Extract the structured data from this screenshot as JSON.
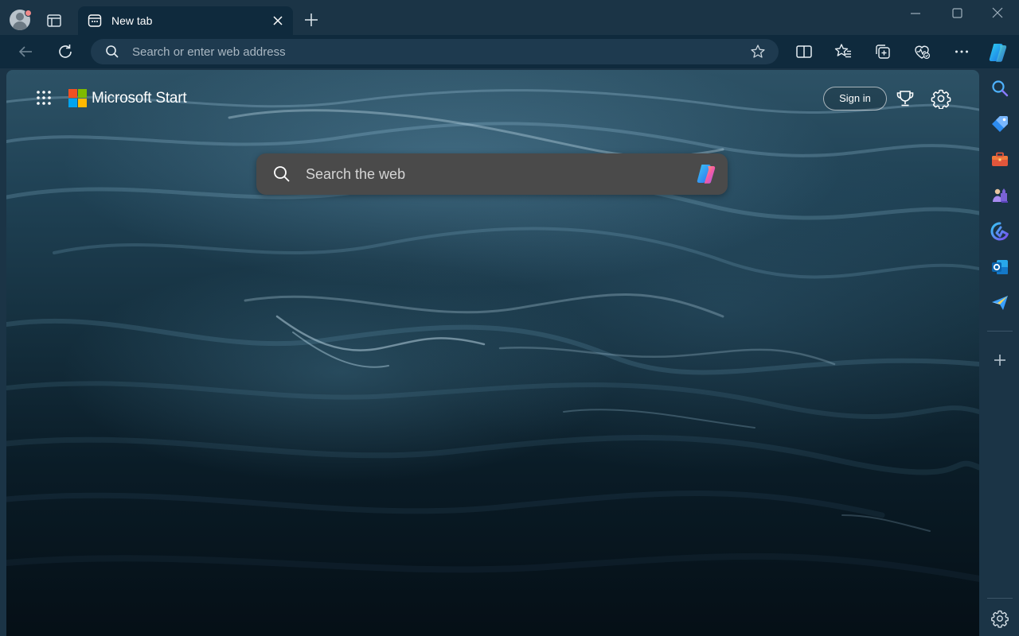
{
  "browser": {
    "tab": {
      "title": "New tab"
    },
    "address_bar": {
      "placeholder": "Search or enter web address"
    }
  },
  "newtab": {
    "brand": "Microsoft Start",
    "sign_in_label": "Sign in",
    "search": {
      "placeholder": "Search the web"
    }
  },
  "colors": {
    "chrome": "#1b3446",
    "toolbar": "#0f2a3d",
    "search_box": "#4a4a4a",
    "ms_red": "#f25022",
    "ms_green": "#7fba00",
    "ms_blue": "#00a4ef",
    "ms_yellow": "#ffb900"
  },
  "icons": {
    "title_bar": [
      "profile-icon",
      "tab-actions-icon",
      "new-tab-page-icon",
      "close-icon",
      "plus-icon",
      "minimize-icon",
      "maximize-icon",
      "window-close-icon"
    ],
    "toolbar": [
      "back-icon",
      "refresh-icon",
      "search-icon",
      "favorite-star-icon",
      "split-screen-icon",
      "favorites-icon",
      "collections-icon",
      "browser-essentials-icon",
      "more-icon",
      "copilot-icon"
    ],
    "sidebar": [
      "search-icon",
      "shopping-icon",
      "tools-icon",
      "games-icon",
      "bing-icon",
      "outlook-icon",
      "send-icon",
      "add-icon",
      "settings-icon"
    ]
  }
}
